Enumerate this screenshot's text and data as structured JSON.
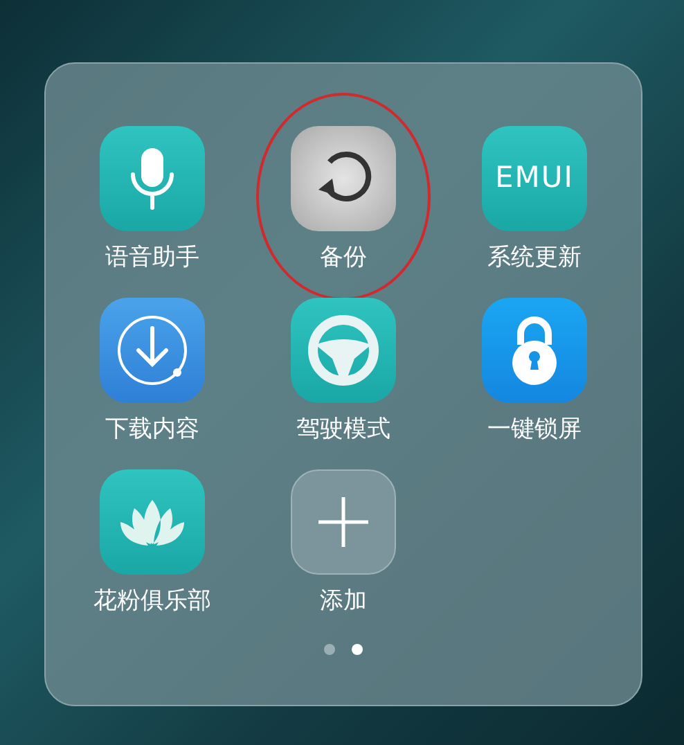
{
  "folder": {
    "apps": [
      {
        "kind": "mic",
        "label": "语音助手",
        "highlighted": false
      },
      {
        "kind": "backup",
        "label": "备份",
        "highlighted": true
      },
      {
        "kind": "emui",
        "label": "系统更新",
        "icon_text": "EMUI",
        "highlighted": false
      },
      {
        "kind": "download",
        "label": "下载内容",
        "highlighted": false
      },
      {
        "kind": "wheel",
        "label": "驾驶模式",
        "highlighted": false
      },
      {
        "kind": "lock",
        "label": "一键锁屏",
        "highlighted": false
      },
      {
        "kind": "lotus",
        "label": "花粉俱乐部",
        "highlighted": false
      },
      {
        "kind": "add",
        "label": "添加",
        "highlighted": false
      }
    ],
    "pages": [
      {
        "selected": false
      },
      {
        "selected": true
      }
    ]
  }
}
